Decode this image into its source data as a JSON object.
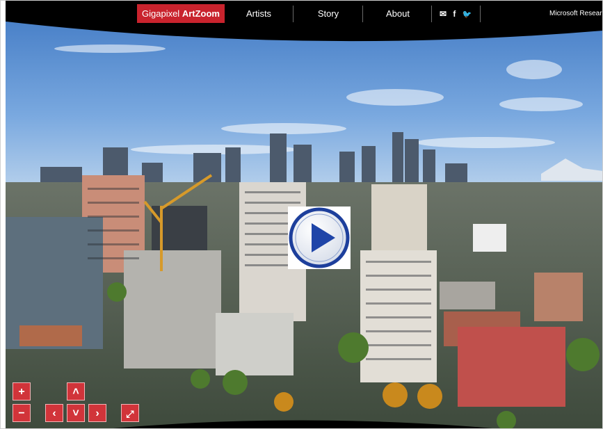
{
  "header": {
    "brand_prefix": "Gigapixel",
    "brand_name": "ArtZoom",
    "nav": [
      {
        "label": "Artists"
      },
      {
        "label": "Story"
      },
      {
        "label": "About"
      }
    ],
    "social": {
      "mail": "✉",
      "facebook": "f",
      "twitter": "🐦"
    },
    "partner": "Microsoft Research"
  },
  "viewer": {
    "image_description_icon": "city-panorama-image",
    "play_icon": "play-icon"
  },
  "controls": {
    "zoom_in": "+",
    "zoom_out": "−",
    "pan_up": "˄",
    "pan_down": "˅",
    "pan_left": "‹",
    "pan_right": "›",
    "fullscreen": "⤢"
  },
  "colors": {
    "accent": "#c9232d",
    "bar": "#000000"
  }
}
